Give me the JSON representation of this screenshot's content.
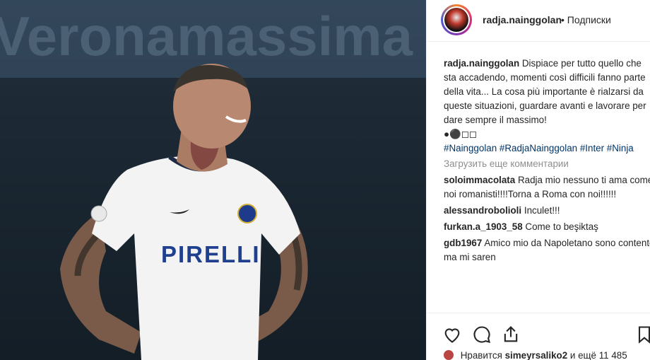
{
  "header": {
    "username": "radja.nainggolan",
    "separator": "•",
    "follow_status": "Подписки"
  },
  "photo": {
    "jersey_sponsor": "PIRELLI",
    "banner_text": "Veronamassima"
  },
  "caption": {
    "username": "radja.nainggolan",
    "text": "Dispiace per tutto quello che sta accadendo, momenti così difficili fanno parte della vita... La cosa più importante è rialzarsi da queste situazioni, guardare avanti e lavorare per dare sempre il massimo!",
    "emoji": "●⚫◻◻",
    "hashtags": "#Nainggolan #RadjaNainggolan #Inter #Ninja"
  },
  "load_more": "Загрузить еще комментарии",
  "comments": [
    {
      "user": "soloimmacolata",
      "text": "Radja mio nessuno ti ama come noi romanisti!!!!Torna a Roma con noi!!!!!!"
    },
    {
      "user": "alessandrobolioli",
      "text": "Inculet!!!"
    },
    {
      "user": "furkan.a_1903_58",
      "text": "Come to beşiktaş"
    },
    {
      "user": "gdb1967",
      "text": "Amico mio da Napoletano sono contento ma mi saren"
    }
  ],
  "likes": {
    "prefix": "Нравится",
    "user": "simeyrsaliko2",
    "suffix": "и ещё 11 485"
  },
  "icons": {
    "like": "heart-icon",
    "comment": "comment-bubble-icon",
    "share": "share-icon",
    "save": "bookmark-icon"
  },
  "colors": {
    "link": "#003569",
    "muted": "#8e8e8e",
    "text": "#262626",
    "border": "#efefef"
  }
}
